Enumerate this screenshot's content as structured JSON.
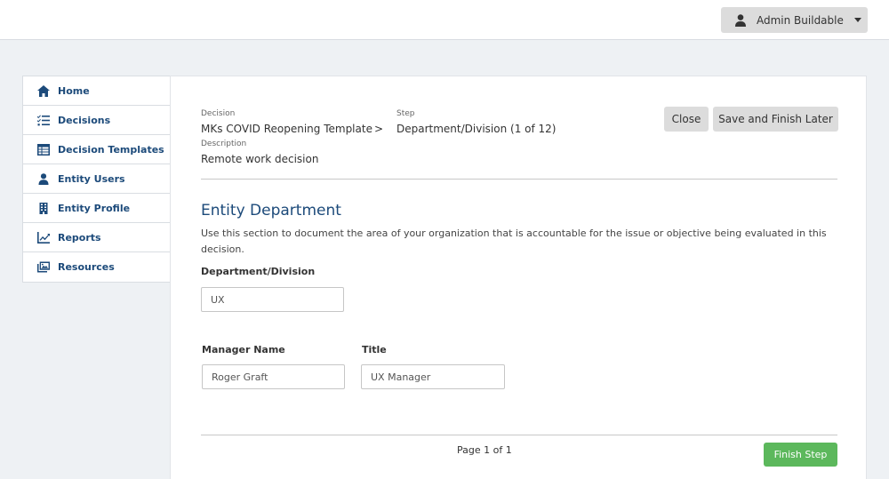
{
  "header": {
    "user_name": "Admin Buildable",
    "user_icon": "user-icon"
  },
  "sidebar": {
    "items": [
      {
        "label": "Home",
        "icon": "home-icon"
      },
      {
        "label": "Decisions",
        "icon": "list-check-icon"
      },
      {
        "label": "Decision Templates",
        "icon": "table-icon"
      },
      {
        "label": "Entity Users",
        "icon": "user-icon"
      },
      {
        "label": "Entity Profile",
        "icon": "building-icon"
      },
      {
        "label": "Reports",
        "icon": "chart-line-icon"
      },
      {
        "label": "Resources",
        "icon": "images-icon"
      }
    ]
  },
  "decision": {
    "decision_label": "Decision",
    "decision_value": "MKs COVID Reopening Template",
    "separator": ">",
    "step_label": "Step",
    "step_value": "Department/Division (1 of 12)",
    "description_label": "Description",
    "description_value": "Remote work decision"
  },
  "actions": {
    "close_label": "Close",
    "save_later_label": "Save and Finish Later"
  },
  "section": {
    "title": "Entity Department",
    "description": "Use this section to document the area of your organization that is accountable for the issue or objective being evaluated in this decision."
  },
  "form": {
    "department_label": "Department/Division",
    "department_value": "UX",
    "manager_label": "Manager Name",
    "manager_value": "Roger Graft",
    "title_label": "Title",
    "title_value": "UX Manager"
  },
  "footer": {
    "page_info": "Page 1 of 1",
    "finish_label": "Finish Step",
    "finish_color": "#5cb85c"
  }
}
